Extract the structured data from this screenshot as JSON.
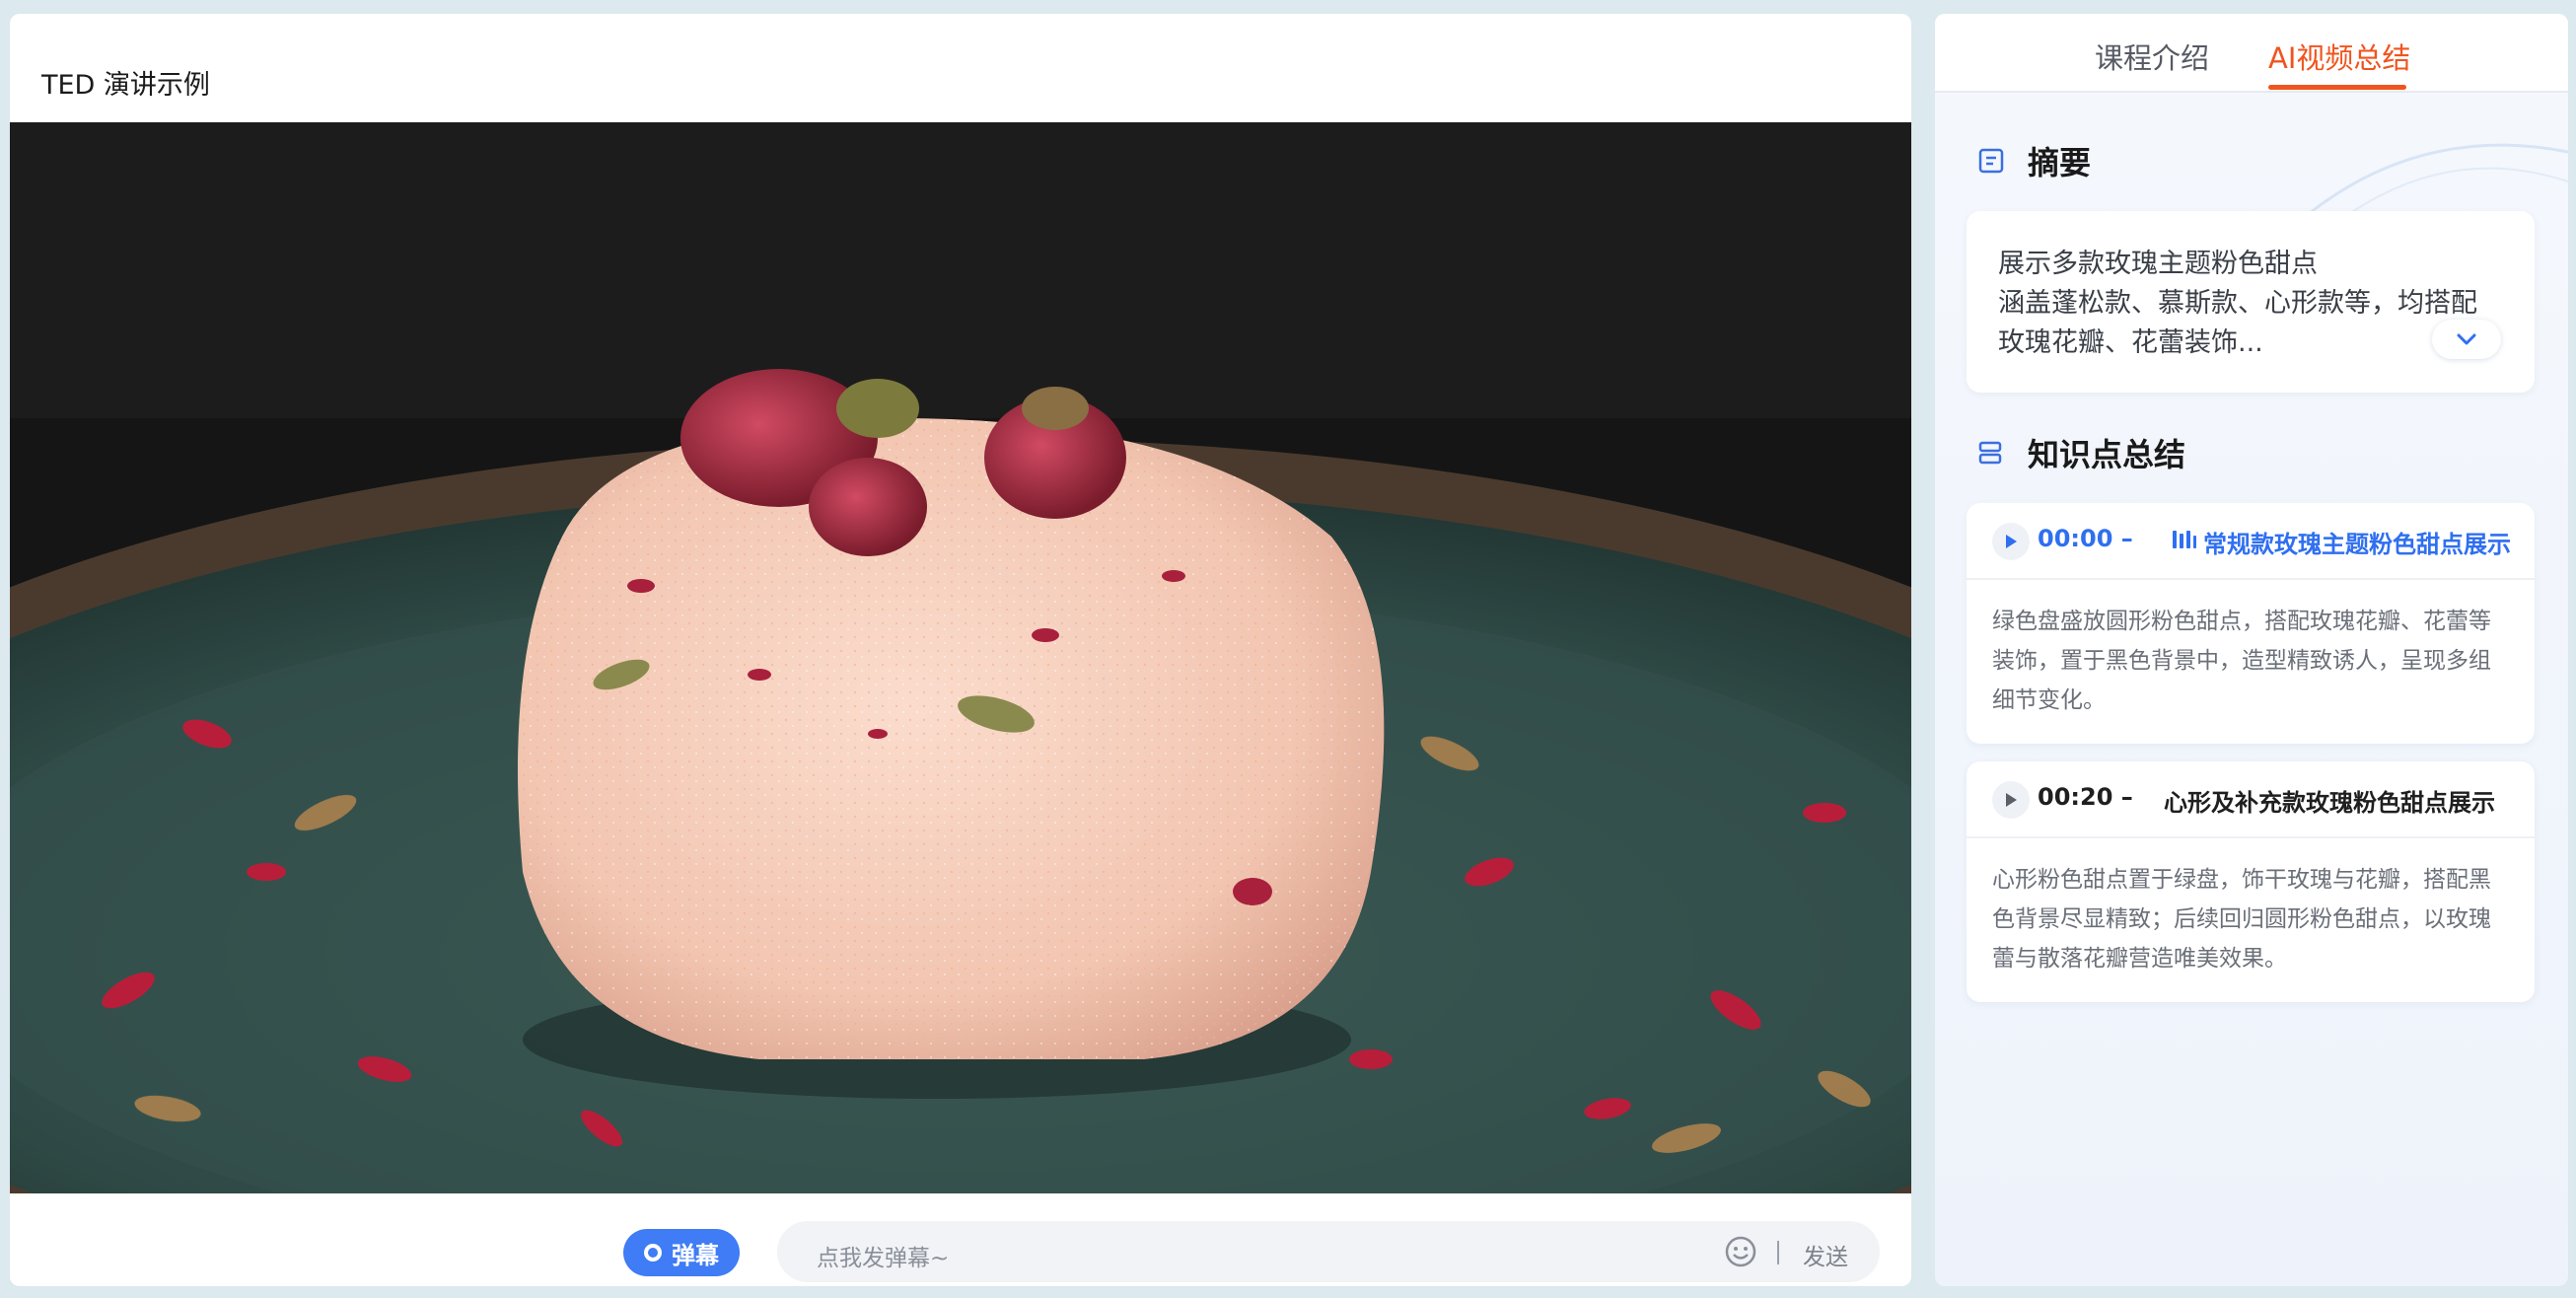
{
  "player": {
    "title": "TED 演讲示例",
    "danmaku_toggle_label": "弹幕",
    "danmaku_placeholder": "点我发弹幕~",
    "send_label": "发送",
    "emoji_icon": "smile-icon"
  },
  "tabs": [
    {
      "label": "课程介绍",
      "active": false
    },
    {
      "label": "AI视频总结",
      "active": true
    }
  ],
  "colors": {
    "accent": "#f0541e",
    "primary": "#2f6ff0",
    "toggle": "#3f7cf5"
  },
  "summary": {
    "title": "摘要",
    "icon": "document-icon",
    "lines": [
      "展示多款玫瑰主题粉色甜点",
      "涵盖蓬松款、慕斯款、心形款等，均搭配",
      "玫瑰花瓣、花蕾装饰..."
    ]
  },
  "knowledge": {
    "title": "知识点总结",
    "icon": "list-icon",
    "items": [
      {
        "time": "00:00 –",
        "title": "常规款玫瑰主题粉色甜点展示",
        "lines": [
          "绿色盘盛放圆形粉色甜点，搭配玫瑰花瓣、花蕾等",
          "装饰，置于黑色背景中，造型精致诱人，呈现多组",
          "细节变化。"
        ]
      },
      {
        "time": "00:20 –",
        "title": "心形及补充款玫瑰粉色甜点展示",
        "lines": [
          "心形粉色甜点置于绿盘，饰干玫瑰与花瓣，搭配黑",
          "色背景尽显精致；后续回归圆形粉色甜点，以玫瑰",
          "蕾与散落花瓣营造唯美效果。"
        ]
      }
    ]
  }
}
